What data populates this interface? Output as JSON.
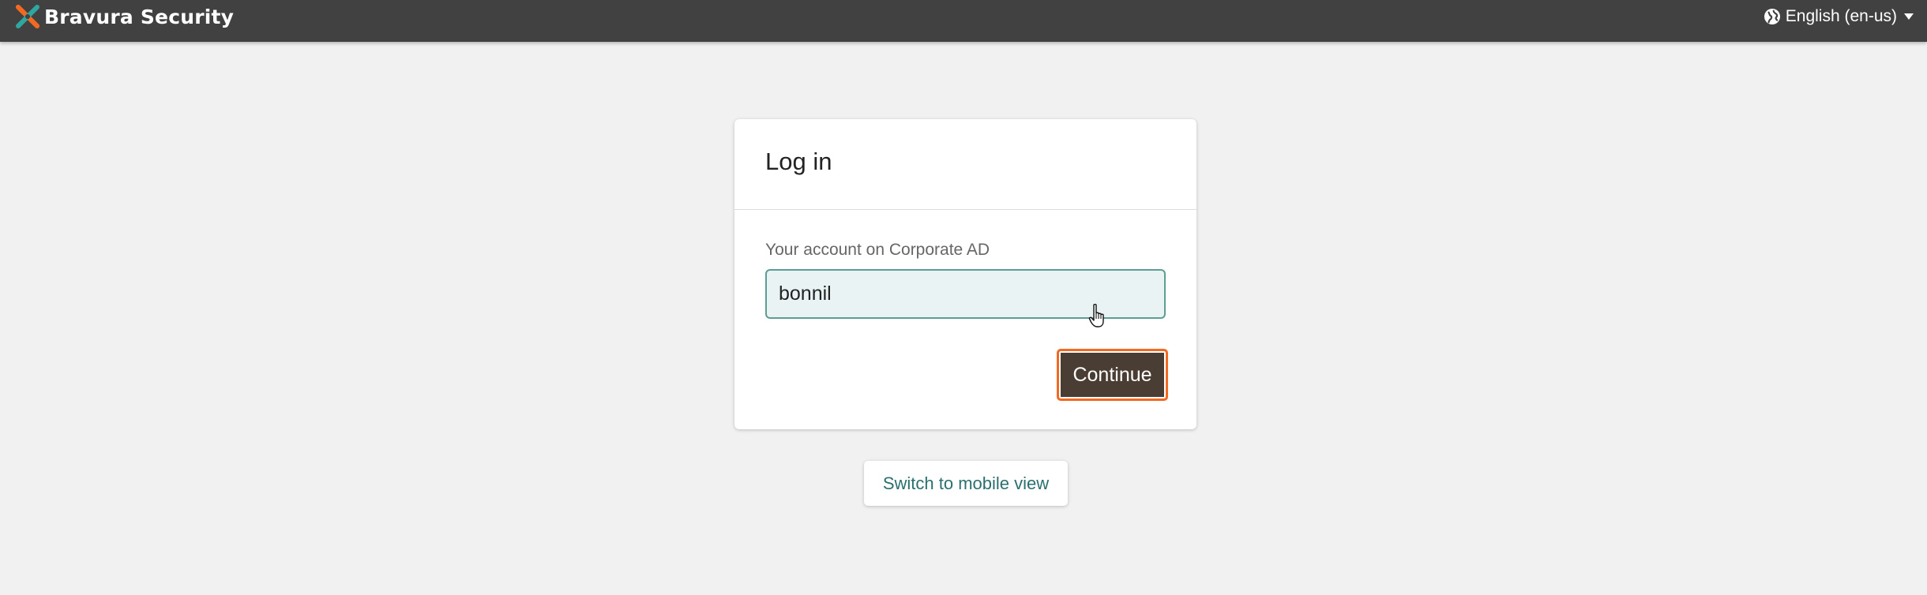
{
  "header": {
    "brand_name": "Bravura Security",
    "logo_icon": "bravura-logo-icon",
    "language": {
      "label": "English (en-us)",
      "icon": "globe-icon",
      "caret_icon": "caret-down-icon"
    },
    "background_color": "#414141"
  },
  "login": {
    "title": "Log in",
    "field_label": "Your account on Corporate AD",
    "account_value": "bonnil",
    "continue_label": "Continue"
  },
  "footer": {
    "mobile_view_label": "Switch to mobile view"
  },
  "colors": {
    "page_background": "#f1f1f1",
    "input_background": "#e9f3f4",
    "input_border": "#5c9d94",
    "button_background": "#4a3d33",
    "button_focus_ring": "#f26a22",
    "link_color": "#2b6f6f"
  }
}
